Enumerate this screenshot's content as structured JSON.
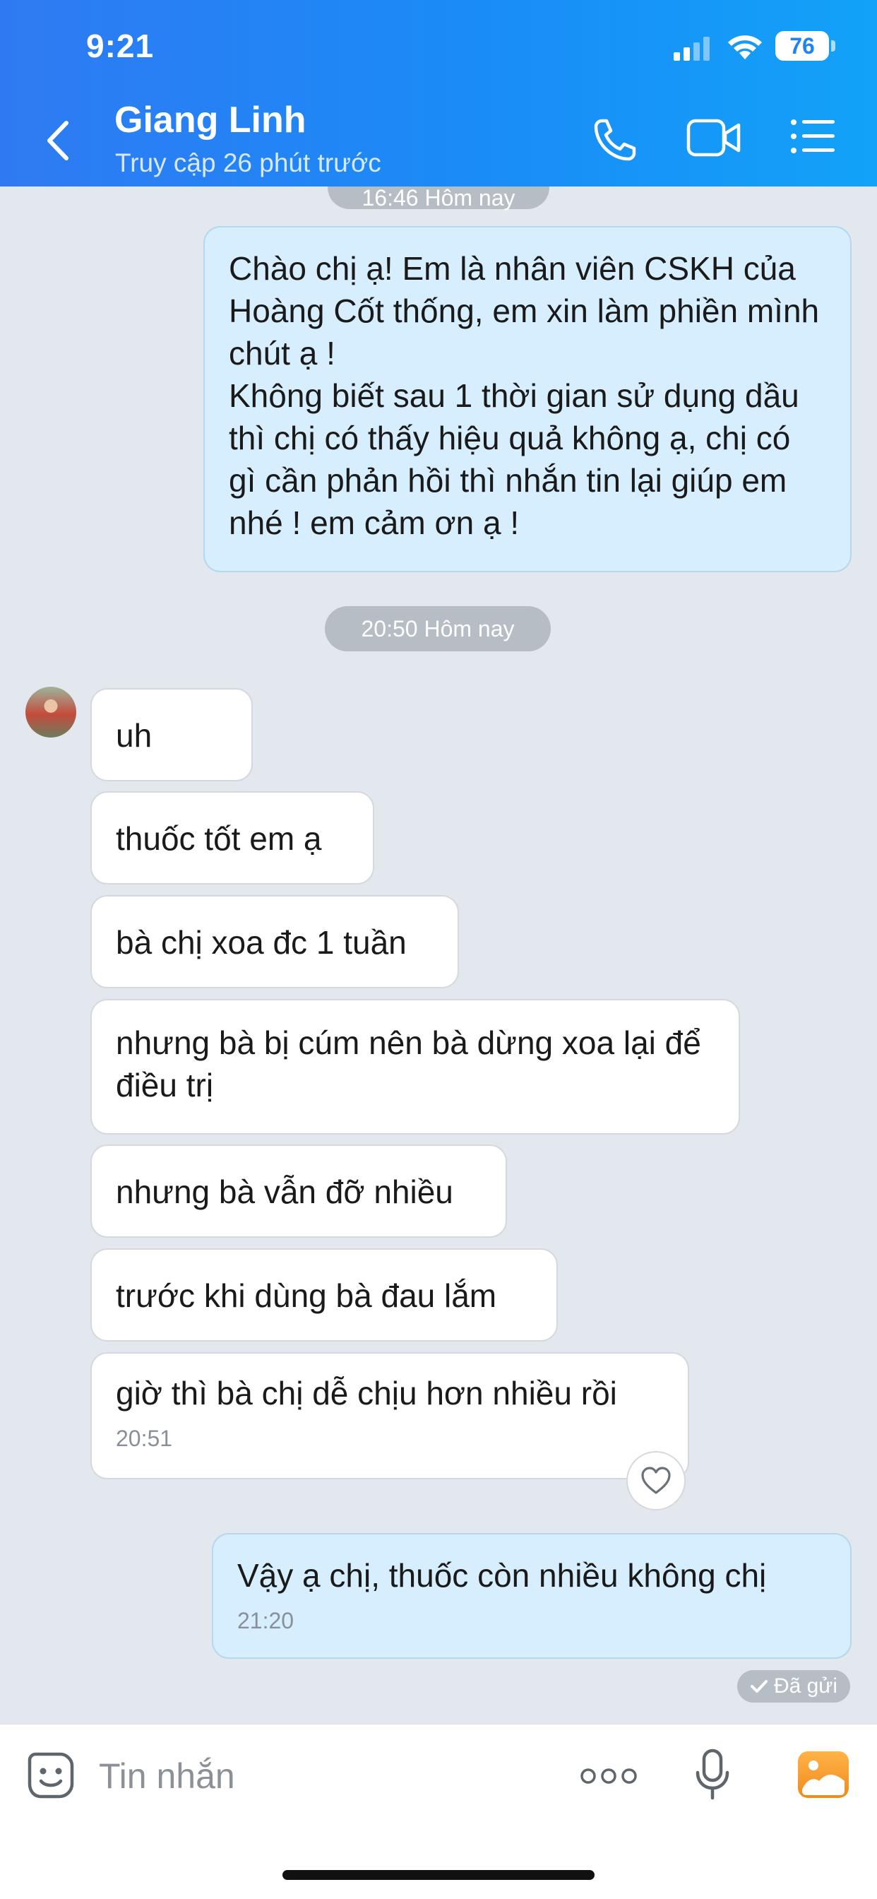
{
  "status_bar": {
    "time": "9:21",
    "battery": "76"
  },
  "header": {
    "contact_name": "Giang Linh",
    "contact_status": "Truy cập 26 phút trước"
  },
  "chat": {
    "top_time_partial": "16:46 Hôm nay",
    "outgoing_first": "Chào chị ạ! Em là nhân viên CSKH của Hoàng Cốt thống, em xin làm phiền mình chút ạ !\n Không biết sau 1 thời gian sử dụng dầu thì chị có thấy hiệu quả không ạ, chị có gì cần phản hồi thì nhắn tin lại giúp em nhé ! em cảm ơn ạ !",
    "time_divider": "20:50 Hôm nay",
    "incoming": [
      "uh",
      "thuốc tốt em ạ",
      "bà chị xoa đc 1 tuần",
      "nhưng bà bị cúm nên bà dừng xoa lại để điều trị",
      "nhưng bà vẫn đỡ nhiều",
      "trước khi dùng bà đau lắm",
      "giờ thì bà chị dễ chịu hơn nhiều rồi"
    ],
    "incoming_last_time": "20:51",
    "outgoing_last": "Vậy ạ chị, thuốc còn nhiều không chị",
    "outgoing_last_time": "21:20",
    "sent_status": "Đã gửi"
  },
  "input": {
    "placeholder": "Tin nhắn"
  },
  "colors": {
    "header_start": "#2f7af2",
    "header_end": "#12a2f8",
    "chat_bg": "#e3e8ef",
    "outgoing_bubble": "#d6eefd",
    "incoming_bubble": "#ffffff"
  }
}
